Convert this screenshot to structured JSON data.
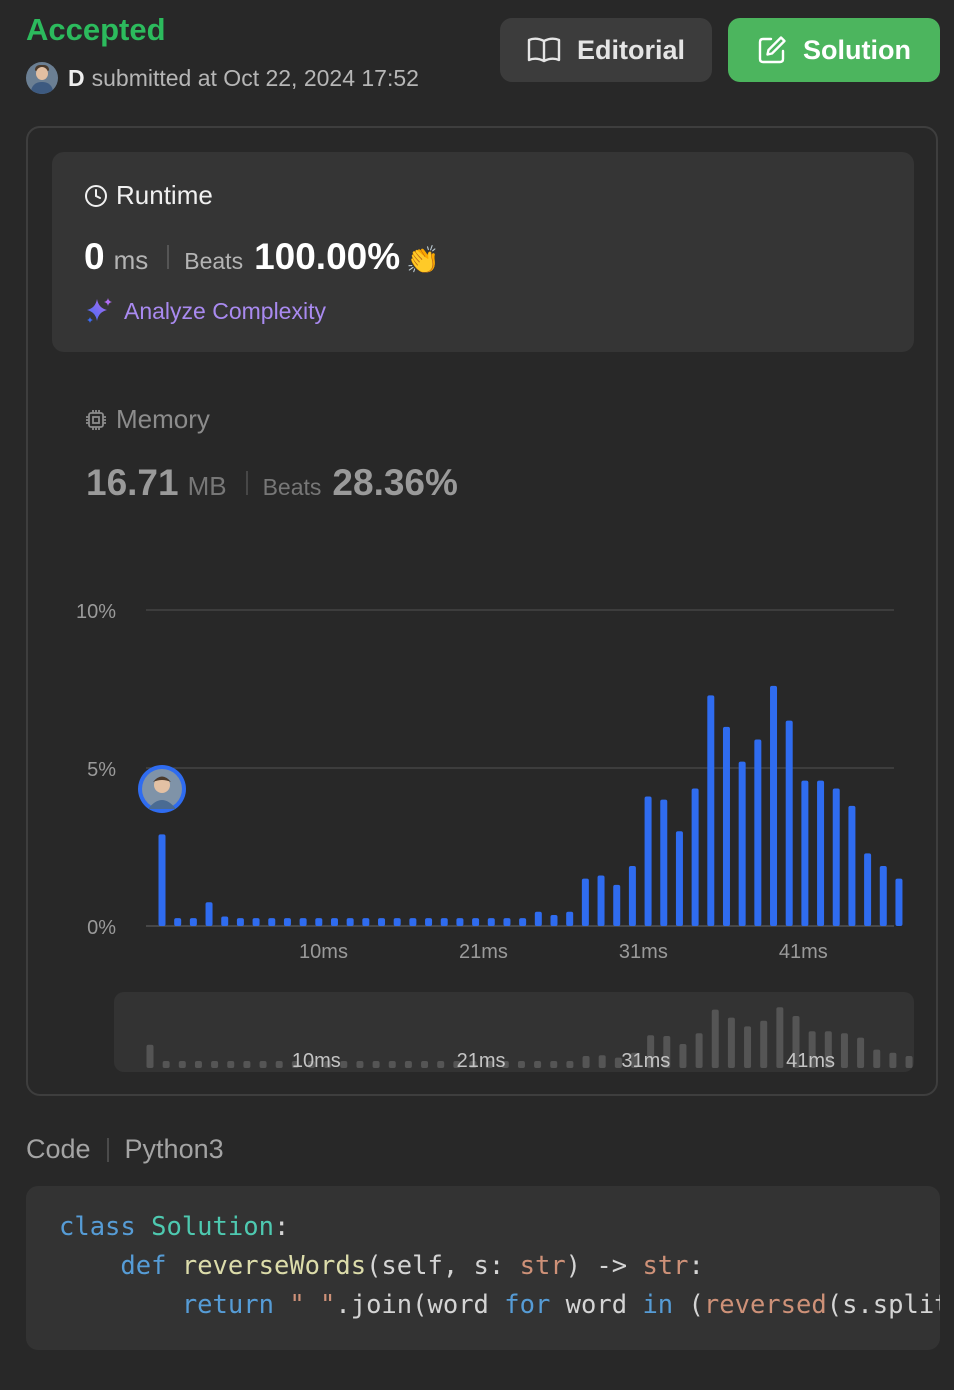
{
  "status": "Accepted",
  "submission": {
    "user": "D",
    "text": "submitted at Oct 22, 2024 17:52"
  },
  "buttons": {
    "editorial": "Editorial",
    "solution": "Solution"
  },
  "runtime": {
    "label": "Runtime",
    "value": "0",
    "unit": "ms",
    "beats_label": "Beats",
    "beats_value": "100.00%",
    "emoji": "👏",
    "analyze_label": "Analyze Complexity"
  },
  "memory": {
    "label": "Memory",
    "value": "16.71",
    "unit": "MB",
    "beats_label": "Beats",
    "beats_value": "28.36%"
  },
  "colors": {
    "accepted": "#2cbb5d",
    "solution_button": "#4cb55e",
    "bar": "#2f6cf0",
    "analyze": "#a98af0"
  },
  "icons": {
    "editorial": "book-open-icon",
    "solution": "edit-pencil-icon",
    "runtime": "clock-icon",
    "memory": "chip-icon",
    "analyze": "sparkle-icon"
  },
  "chart_data": {
    "type": "bar",
    "xlabel": "",
    "ylabel": "",
    "ylim": [
      0,
      10
    ],
    "y_ticks": [
      "10%",
      "5%",
      "0%"
    ],
    "x_ticks": [
      "10ms",
      "21ms",
      "31ms",
      "41ms"
    ],
    "x_tick_positions": [
      11.3,
      21.5,
      31.7,
      41.9
    ],
    "grid": true,
    "highlighted_bar": 0,
    "values": [
      2.9,
      0.25,
      0.25,
      0.75,
      0.3,
      0.25,
      0.25,
      0.25,
      0.25,
      0.25,
      0.25,
      0.25,
      0.25,
      0.25,
      0.25,
      0.25,
      0.25,
      0.25,
      0.25,
      0.25,
      0.25,
      0.25,
      0.25,
      0.25,
      0.45,
      0.35,
      0.45,
      1.5,
      1.6,
      1.3,
      1.9,
      4.1,
      4.0,
      3.0,
      4.35,
      7.3,
      6.3,
      5.2,
      5.9,
      7.6,
      6.5,
      4.6,
      4.6,
      4.35,
      3.8,
      2.3,
      1.9,
      1.5
    ]
  },
  "code": {
    "label": "Code",
    "language": "Python3"
  }
}
